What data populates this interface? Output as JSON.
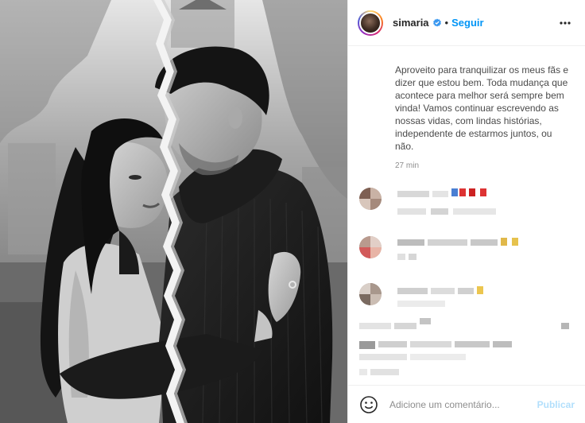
{
  "post": {
    "username": "simaria",
    "separator": "•",
    "follow_label": "Seguir",
    "caption": "Aproveito para tranquilizar os meus fãs e dizer que estou bem. Toda mudança que acontece para melhor será sempre bem vinda! Vamos continuar escrevendo as nossas vidas, com lindas histórias, independente de estarmos juntos, ou não.",
    "time_ago": "27 min"
  },
  "icons": {
    "verified": "verified-badge-icon",
    "more": "more-options-icon",
    "emoji": "emoji-smiley-icon"
  },
  "composer": {
    "placeholder": "Adicione um comentário...",
    "publish_label": "Publicar"
  },
  "colors": {
    "link_blue": "#0095f6",
    "publish_disabled": "#b2dffc",
    "divider": "#efefef"
  }
}
